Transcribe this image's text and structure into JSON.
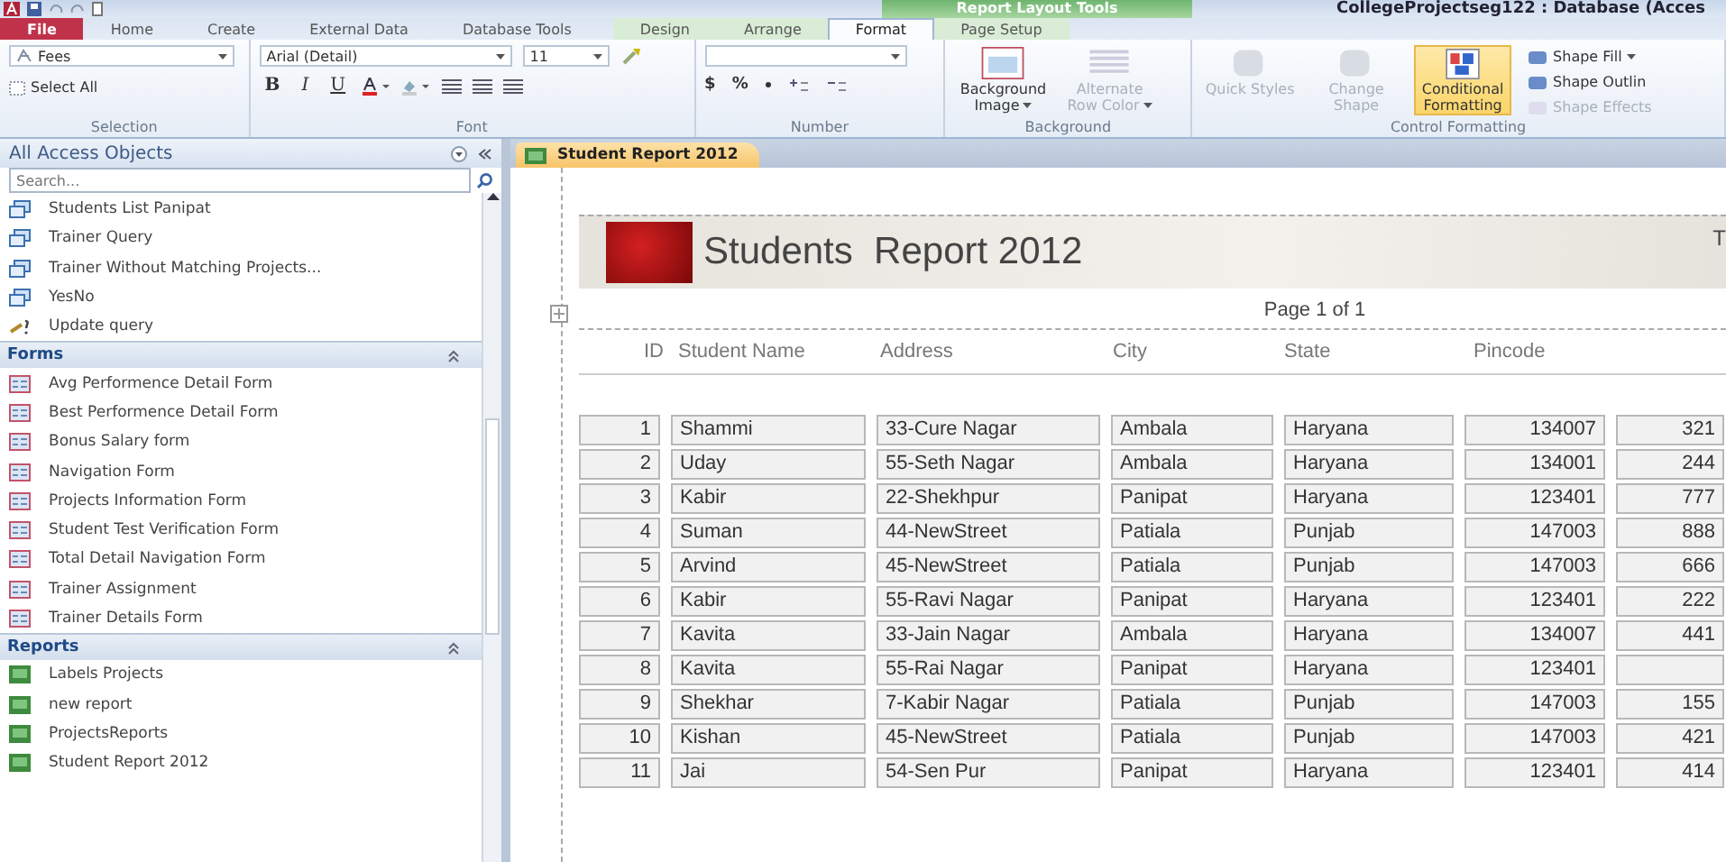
{
  "window": {
    "title": "CollegeProjectseg122 : Database (Acces",
    "contextual_group": "Report Layout Tools"
  },
  "ribbon_tabs": [
    {
      "label": "File",
      "kind": "file",
      "selected": false
    },
    {
      "label": "Home",
      "kind": "plain",
      "selected": false
    },
    {
      "label": "Create",
      "kind": "plain",
      "selected": false
    },
    {
      "label": "External Data",
      "kind": "plain",
      "selected": false
    },
    {
      "label": "Database Tools",
      "kind": "plain",
      "selected": false
    },
    {
      "label": "Design",
      "kind": "context",
      "selected": false
    },
    {
      "label": "Arrange",
      "kind": "context",
      "selected": false
    },
    {
      "label": "Format",
      "kind": "context",
      "selected": true
    },
    {
      "label": "Page Setup",
      "kind": "context",
      "selected": false
    }
  ],
  "ribbon": {
    "selection": {
      "label": "Selection",
      "object_combo": "Fees",
      "select_all": "Select All"
    },
    "font": {
      "label": "Font",
      "font_name": "Arial (Detail)",
      "font_size": "11",
      "bold": "B",
      "italic": "I",
      "underline": "U"
    },
    "number": {
      "label": "Number",
      "symbols": [
        "$",
        "%"
      ]
    },
    "background": {
      "label": "Background",
      "buttons": [
        {
          "label": "Background Image",
          "disabled": false
        },
        {
          "label": "Alternate Row Color",
          "disabled": true
        }
      ]
    },
    "control_formatting": {
      "label": "Control Formatting",
      "buttons": [
        {
          "label": "Quick Styles",
          "disabled": true,
          "highlighted": false
        },
        {
          "label": "Change Shape",
          "disabled": true,
          "highlighted": false
        },
        {
          "label": "Conditional Formatting",
          "disabled": false,
          "highlighted": true
        }
      ],
      "small_buttons": [
        {
          "label": "Shape Fill",
          "disabled": false
        },
        {
          "label": "Shape Outlin",
          "disabled": false
        },
        {
          "label": "Shape Effects",
          "disabled": true
        }
      ]
    }
  },
  "nav_pane": {
    "title": "All Access Objects",
    "search_placeholder": "Search...",
    "top_items": [
      {
        "label": "Students List Panipat",
        "kind": "query"
      },
      {
        "label": "Trainer Query",
        "kind": "query"
      },
      {
        "label": "Trainer Without Matching Projects...",
        "kind": "query"
      },
      {
        "label": "YesNo",
        "kind": "query"
      },
      {
        "label": "Update query",
        "kind": "update"
      }
    ],
    "groups": [
      {
        "title": "Forms",
        "expanded": true,
        "items": [
          {
            "label": "Avg Performence Detail Form",
            "kind": "form"
          },
          {
            "label": "Best Performence Detail Form",
            "kind": "form"
          },
          {
            "label": "Bonus Salary form",
            "kind": "form"
          },
          {
            "label": "Navigation Form",
            "kind": "form"
          },
          {
            "label": "Projects Information Form",
            "kind": "form"
          },
          {
            "label": "Student Test Verification Form",
            "kind": "form"
          },
          {
            "label": "Total Detail Navigation Form",
            "kind": "form"
          },
          {
            "label": "Trainer Assignment",
            "kind": "form"
          },
          {
            "label": "Trainer Details Form",
            "kind": "form"
          }
        ]
      },
      {
        "title": "Reports",
        "expanded": true,
        "items": [
          {
            "label": "Labels Projects",
            "kind": "report"
          },
          {
            "label": "new report",
            "kind": "report"
          },
          {
            "label": "ProjectsReports",
            "kind": "report"
          },
          {
            "label": "Student Report 2012",
            "kind": "report"
          }
        ]
      }
    ]
  },
  "document_tabs": [
    {
      "label": "Student Report 2012",
      "selected": true
    }
  ],
  "report": {
    "title": "Students  Report 2012",
    "title_right": "T",
    "page": "Page 1 of 1",
    "columns": [
      "ID",
      "Student Name",
      "Address",
      "City",
      "State",
      "Pincode"
    ],
    "rows": [
      [
        "1",
        "Shammi",
        "33-Cure Nagar",
        "Ambala",
        "Haryana",
        "134007",
        "321"
      ],
      [
        "2",
        "Uday",
        "55-Seth Nagar",
        "Ambala",
        "Haryana",
        "134001",
        "244"
      ],
      [
        "3",
        "Kabir",
        "22-Shekhpur",
        "Panipat",
        "Haryana",
        "123401",
        "777"
      ],
      [
        "4",
        "Suman",
        "44-NewStreet",
        "Patiala",
        "Punjab",
        "147003",
        "888"
      ],
      [
        "5",
        "Arvind",
        "45-NewStreet",
        "Patiala",
        "Punjab",
        "147003",
        "666"
      ],
      [
        "6",
        "Kabir",
        "55-Ravi Nagar",
        "Panipat",
        "Haryana",
        "123401",
        "222"
      ],
      [
        "7",
        "Kavita",
        "33-Jain Nagar",
        "Ambala",
        "Haryana",
        "134007",
        "441"
      ],
      [
        "8",
        "Kavita",
        "55-Rai Nagar",
        "Panipat",
        "Haryana",
        "123401",
        ""
      ],
      [
        "9",
        "Shekhar",
        "7-Kabir Nagar",
        "Patiala",
        "Punjab",
        "147003",
        "155"
      ],
      [
        "10",
        "Kishan",
        "45-NewStreet",
        "Patiala",
        "Punjab",
        "147003",
        "421"
      ],
      [
        "11",
        "Jai",
        "54-Sen Pur",
        "Panipat",
        "Haryana",
        "123401",
        "414"
      ]
    ]
  }
}
